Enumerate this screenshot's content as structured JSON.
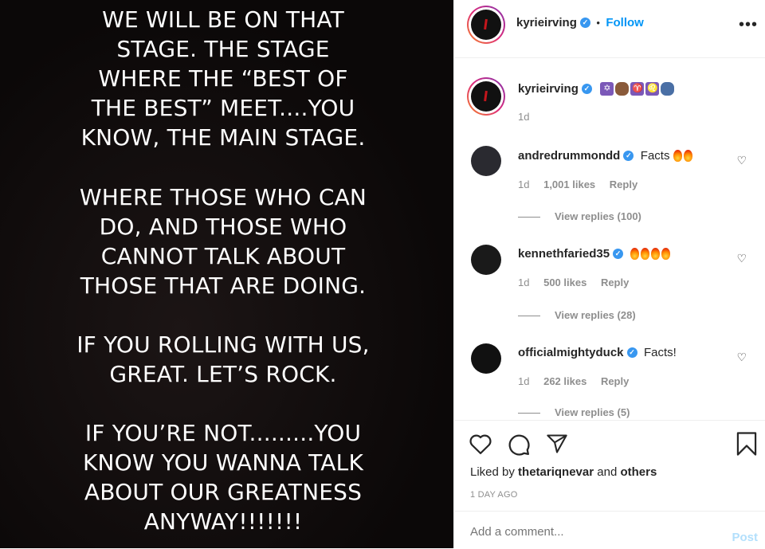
{
  "post_text": [
    [
      "WE WILL BE ON THAT",
      "STAGE. THE STAGE",
      "WHERE THE “BEST OF",
      "THE BEST” MEET....YOU",
      "KNOW, THE MAIN STAGE."
    ],
    [
      "WHERE THOSE WHO CAN",
      "DO, AND THOSE WHO",
      "CANNOT TALK ABOUT",
      "THOSE THAT ARE DOING."
    ],
    [
      "IF YOU ROLLING WITH US,",
      "GREAT. LET’S ROCK."
    ],
    [
      "IF YOU’RE NOT.........YOU",
      "KNOW YOU WANNA TALK",
      "ABOUT OUR GREATNESS",
      "ANYWAY!!!!!!!"
    ]
  ],
  "header": {
    "username": "kyrieirving",
    "separator": "•",
    "follow_label": "Follow",
    "more_icon": "more-options-icon"
  },
  "caption": {
    "username": "kyrieirving",
    "emojis": [
      "star-of-david",
      "fist-dark",
      "aries",
      "leo",
      "people-hugging"
    ],
    "time": "1d"
  },
  "comments": [
    {
      "username": "andredrummondd",
      "text": "Facts",
      "flames": 2,
      "time": "1d",
      "likes": "1,001 likes",
      "reply_label": "Reply",
      "view_replies": "View replies (100)"
    },
    {
      "username": "kennethfaried35",
      "text": "",
      "flames": 4,
      "time": "1d",
      "likes": "500 likes",
      "reply_label": "Reply",
      "view_replies": "View replies (28)"
    },
    {
      "username": "officialmightyduck",
      "text": "Facts!",
      "flames": 0,
      "time": "1d",
      "likes": "262 likes",
      "reply_label": "Reply",
      "view_replies": "View replies (5)"
    }
  ],
  "actions": {
    "liked_by_prefix": "Liked by",
    "liked_by_user": "thetariqnevar",
    "liked_by_and": "and",
    "liked_by_others": "others",
    "timestamp": "1 DAY AGO"
  },
  "add_comment": {
    "placeholder": "Add a comment...",
    "post_label": "Post"
  },
  "colors": {
    "accent": "#0095f6",
    "verified": "#3897f0",
    "image_bg": "#0b0808"
  }
}
